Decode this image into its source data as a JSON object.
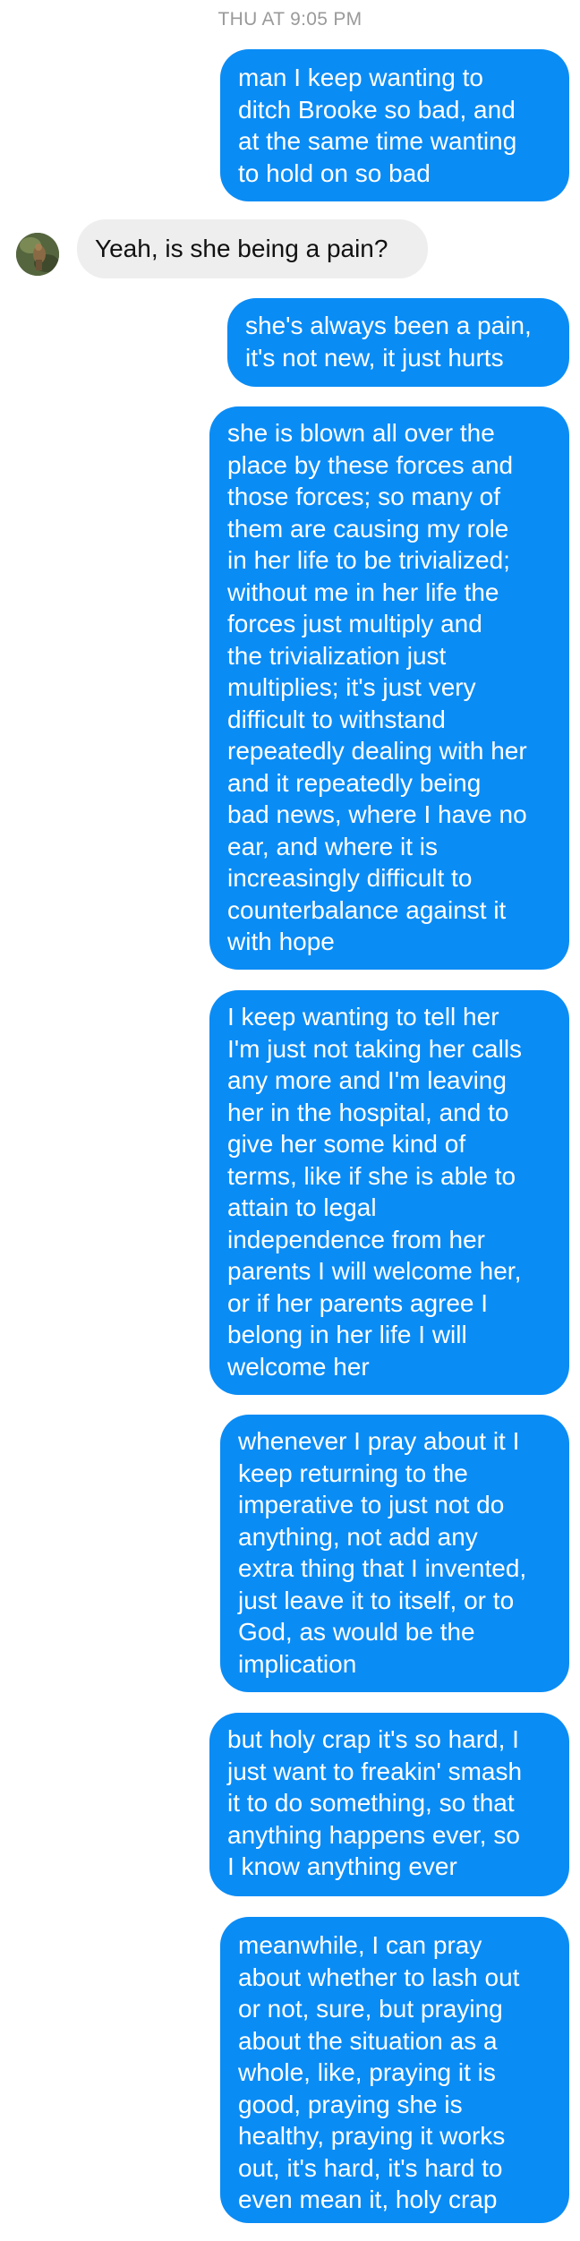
{
  "header": {
    "timestamp": "THU AT 9:05 PM"
  },
  "contact": {
    "avatar_icon": "contact-avatar-photo"
  },
  "colors": {
    "outgoing_bubble": "#0a8cf5",
    "incoming_bubble": "#eeeeee",
    "timestamp_text": "#9a9a9a"
  },
  "messages": [
    {
      "direction": "outgoing",
      "text": "man I keep wanting to\nditch Brooke so bad, and\nat the same time wanting\nto hold on so bad"
    },
    {
      "direction": "incoming",
      "text": "Yeah, is she being a pain?"
    },
    {
      "direction": "outgoing",
      "text": "she's always been a pain,\nit's not new, it just hurts"
    },
    {
      "direction": "outgoing",
      "text": "she is blown all over the\nplace by these forces and\nthose forces; so many of\nthem are causing my role\nin her life to be trivialized;\nwithout me in her life the\nforces just multiply and\nthe trivialization just\nmultiplies; it's just very\ndifficult to withstand\nrepeatedly dealing with her\nand it repeatedly being\nbad news, where I have no\near, and where it is\nincreasingly difficult to\ncounterbalance against it\nwith hope"
    },
    {
      "direction": "outgoing",
      "text": "I keep wanting to tell her\nI'm just not taking her calls\nany more and I'm leaving\nher in the hospital, and to\ngive her some kind of\nterms, like if she is able to\nattain to legal\nindependence from her\nparents I will welcome her,\nor if her parents agree I\nbelong in her life I will\nwelcome her"
    },
    {
      "direction": "outgoing",
      "text": "whenever I pray about it I\nkeep returning to the\nimperative to just not do\nanything, not add any\nextra thing that I invented,\njust leave it to itself, or to\nGod, as would be the\nimplication"
    },
    {
      "direction": "outgoing",
      "text": "but holy crap it's so hard, I\njust want to freakin' smash\nit to do something, so that\nanything happens ever, so\nI know anything ever"
    },
    {
      "direction": "outgoing",
      "text": "meanwhile, I can pray\nabout whether to lash out\nor not, sure, but praying\nabout the situation as a\nwhole, like, praying it is\ngood, praying she is\nhealthy, praying it works\nout, it's hard, it's hard to\neven mean it, holy crap"
    }
  ]
}
